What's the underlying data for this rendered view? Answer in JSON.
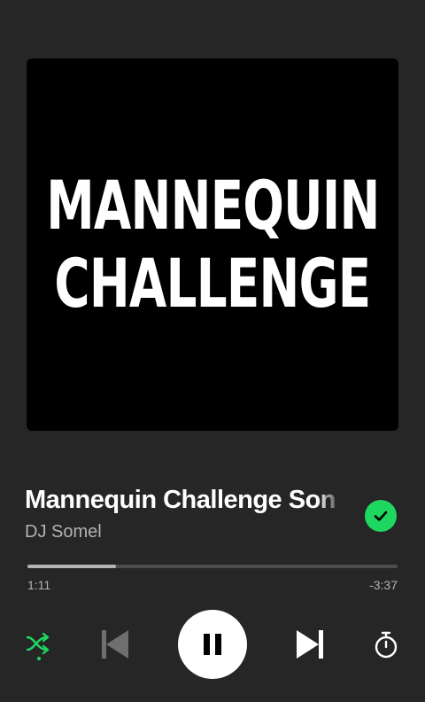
{
  "album_art": {
    "line1": "MANNEQUIN",
    "line2": "CHALLENGE"
  },
  "track": {
    "title": "Mannequin Challenge Son",
    "artist": "DJ Somel",
    "liked": true
  },
  "progress": {
    "fraction": 0.24,
    "elapsed": "1:11",
    "remaining": "-3:37"
  },
  "controls": {
    "shuffle_icon": "shuffle-icon",
    "shuffle_active_color": "#1ed760",
    "previous_icon": "skip-previous-icon",
    "play_pause_icon": "pause-icon",
    "next_icon": "skip-next-icon",
    "timer_icon": "sleep-timer-icon"
  },
  "colors": {
    "background": "#262626",
    "accent": "#1ed760",
    "secondary_text": "#b3b3b3"
  }
}
